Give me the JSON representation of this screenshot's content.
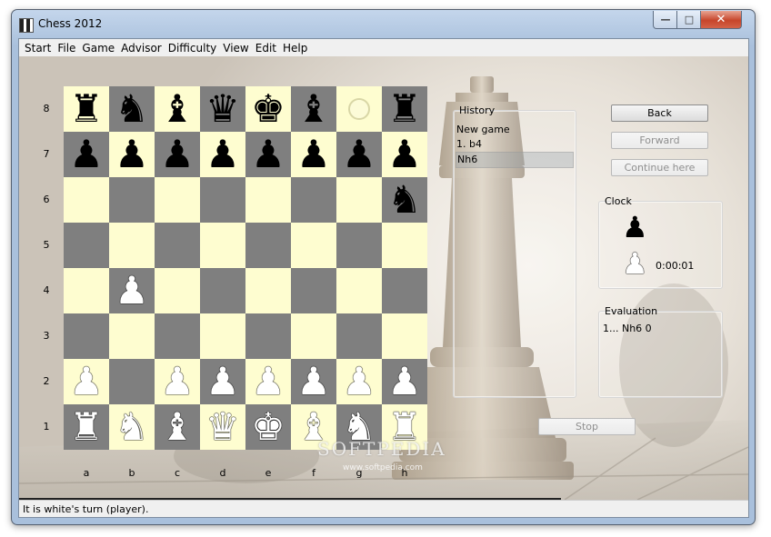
{
  "window": {
    "title": "Chess 2012"
  },
  "menu": [
    "Start",
    "File",
    "Game",
    "Advisor",
    "Difficulty",
    "View",
    "Edit",
    "Help"
  ],
  "board": {
    "ranks": [
      "8",
      "7",
      "6",
      "5",
      "4",
      "3",
      "2",
      "1"
    ],
    "files": [
      "a",
      "b",
      "c",
      "d",
      "e",
      "f",
      "g",
      "h"
    ],
    "rows": [
      [
        "bR",
        "bN",
        "bB",
        "bQ",
        "bK",
        "bB",
        "hl",
        "bR"
      ],
      [
        "bP",
        "bP",
        "bP",
        "bP",
        "bP",
        "bP",
        "bP",
        "bP"
      ],
      [
        "",
        "",
        "",
        "",
        "",
        "",
        "",
        "bN"
      ],
      [
        "",
        "",
        "",
        "",
        "",
        "",
        "",
        ""
      ],
      [
        "",
        "wP",
        "",
        "",
        "",
        "",
        "",
        ""
      ],
      [
        "",
        "",
        "",
        "",
        "",
        "",
        "",
        ""
      ],
      [
        "wP",
        "",
        "wP",
        "wP",
        "wP",
        "wP",
        "wP",
        "wP"
      ],
      [
        "wR",
        "wN",
        "wB",
        "wQ",
        "wK",
        "wB",
        "wN",
        "wR"
      ]
    ],
    "selected_square": "h6"
  },
  "history": {
    "title": "History",
    "moves": [
      "New game",
      "1. b4",
      "Nh6"
    ],
    "selected_index": 2
  },
  "buttons": {
    "back": "Back",
    "forward": "Forward",
    "continue_here": "Continue here",
    "stop": "Stop"
  },
  "clock": {
    "title": "Clock",
    "white_time": "0:00:01"
  },
  "evaluation": {
    "title": "Evaluation",
    "text": "1... Nh6 0"
  },
  "watermark": {
    "text": "SOFTPEDIA",
    "url": "www.softpedia.com"
  },
  "status": {
    "text": "It is white's turn (player)."
  }
}
